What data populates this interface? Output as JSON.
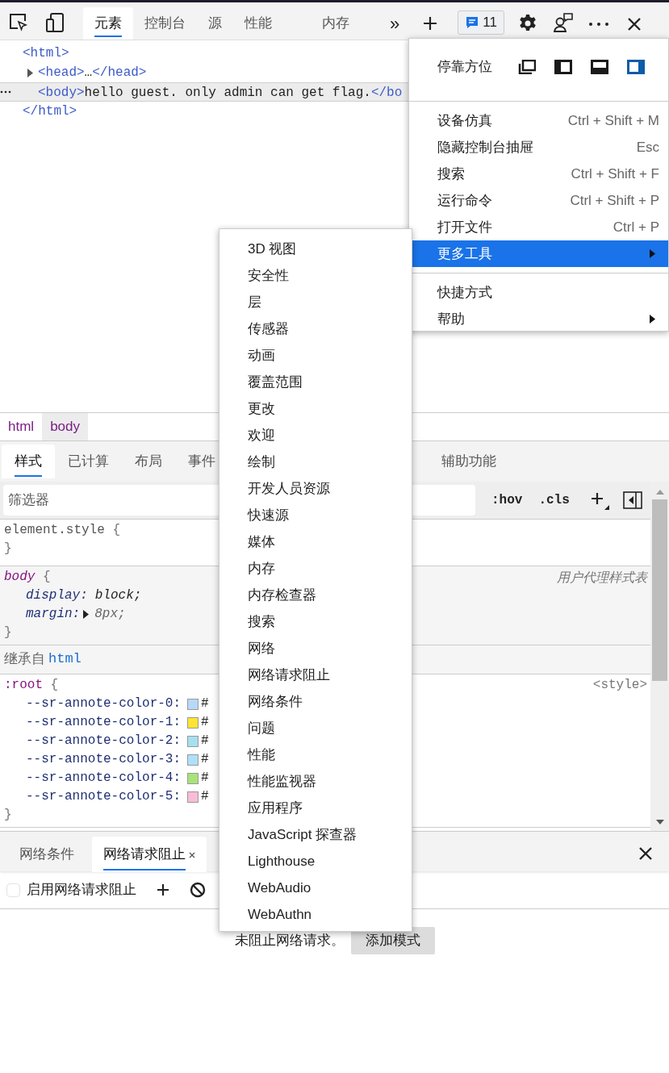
{
  "toolbar": {
    "tabs": [
      {
        "label": "元素",
        "selected": true
      },
      {
        "label": "控制台",
        "selected": false
      },
      {
        "label": "源",
        "selected": false
      },
      {
        "label": "性能",
        "selected": false
      },
      {
        "label": "内存",
        "selected": false
      }
    ],
    "overflow": "»",
    "issues": "11"
  },
  "dom_tree": [
    {
      "parts": [
        {
          "kind": "tag",
          "text": "<html>"
        }
      ],
      "collapsed": false,
      "selected": false,
      "children": [
        {
          "parts": [
            {
              "kind": "tag",
              "text": "<head>"
            },
            {
              "kind": "text",
              "text": "…"
            },
            {
              "kind": "tag",
              "text": "</head>"
            }
          ],
          "collapsed": true,
          "selected": false
        },
        {
          "parts": [
            {
              "kind": "tag",
              "text": "<body>"
            },
            {
              "kind": "text",
              "text": "hello guest. only admin can get flag."
            },
            {
              "kind": "tag",
              "text": "</bo"
            }
          ],
          "collapsed": false,
          "selected": true
        }
      ],
      "closing": [
        {
          "kind": "tag",
          "text": "</html>"
        }
      ]
    }
  ],
  "breadcrumbs": [
    {
      "label": "html",
      "selected": false
    },
    {
      "label": "body",
      "selected": true
    }
  ],
  "styles_tabs": [
    {
      "label": "样式",
      "selected": true
    },
    {
      "label": "已计算",
      "selected": false
    },
    {
      "label": "布局",
      "selected": false
    },
    {
      "label": "事件",
      "selected": false
    },
    {
      "label": "辅助功能",
      "selected": false
    }
  ],
  "filter": {
    "placeholder": "筛选器",
    "toggles": [
      ":hov",
      ".cls"
    ]
  },
  "rules": [
    {
      "kind": "inline",
      "selector": "element.style",
      "open": "{",
      "close": "}"
    },
    {
      "kind": "user-agent",
      "selector": "body",
      "open": "{",
      "close": "}",
      "origin": "用户代理样式表",
      "declarations": [
        {
          "name": "display:",
          "value": "block;",
          "expandable": false
        },
        {
          "name": "margin:",
          "value": "8px;",
          "expandable": true
        }
      ]
    },
    {
      "kind": "inherited",
      "label": "继承自",
      "element": "html"
    },
    {
      "kind": "author",
      "selector": ":root",
      "open": "{",
      "close": "}",
      "origin": "<style>",
      "variables": [
        {
          "name": "--sr-annote-color-0:",
          "color": "#b8d8f8",
          "value": "#"
        },
        {
          "name": "--sr-annote-color-1:",
          "color": "#ffe433",
          "value": "#"
        },
        {
          "name": "--sr-annote-color-2:",
          "color": "#a6e0f0",
          "value": "#"
        },
        {
          "name": "--sr-annote-color-3:",
          "color": "#aee0fa",
          "value": "#"
        },
        {
          "name": "--sr-annote-color-4:",
          "color": "#a8e37a",
          "value": "#"
        },
        {
          "name": "--sr-annote-color-5:",
          "color": "#f8bcd8",
          "value": "#"
        }
      ]
    }
  ],
  "drawer": {
    "tabs": [
      {
        "label": "网络条件",
        "selected": false,
        "closable": false
      },
      {
        "label": "网络请求阻止",
        "selected": true,
        "closable": true
      }
    ],
    "enable": {
      "label": "启用网络请求阻止",
      "checked": false
    },
    "empty_message": "未阻止网络请求。",
    "add_button": "添加模式"
  },
  "main_menu": {
    "dock": {
      "label": "停靠方位",
      "options": [
        {
          "kind": "undock",
          "selected": false
        },
        {
          "kind": "left",
          "selected": false
        },
        {
          "kind": "bottom",
          "selected": false
        },
        {
          "kind": "right",
          "selected": true
        }
      ]
    },
    "groups": [
      [
        {
          "label": "设备仿真",
          "shortcut": "Ctrl + Shift + M",
          "submenu": false,
          "selected": false
        },
        {
          "label": "隐藏控制台抽屉",
          "shortcut": "Esc",
          "submenu": false,
          "selected": false
        },
        {
          "label": "搜索",
          "shortcut": "Ctrl + Shift + F",
          "submenu": false,
          "selected": false
        },
        {
          "label": "运行命令",
          "shortcut": "Ctrl + Shift + P",
          "submenu": false,
          "selected": false
        },
        {
          "label": "打开文件",
          "shortcut": "Ctrl + P",
          "submenu": false,
          "selected": false
        },
        {
          "label": "更多工具",
          "submenu": true,
          "selected": true
        }
      ],
      [
        {
          "label": "快捷方式",
          "submenu": false,
          "selected": false
        },
        {
          "label": "帮助",
          "submenu": true,
          "selected": false
        }
      ]
    ]
  },
  "more_tools_menu": [
    "3D 视图",
    "安全性",
    "层",
    "传感器",
    "动画",
    "覆盖范围",
    "更改",
    "欢迎",
    "绘制",
    "开发人员资源",
    "快速源",
    "媒体",
    "内存",
    "内存检查器",
    "搜索",
    "网络",
    "网络请求阻止",
    "网络条件",
    "问题",
    "性能",
    "性能监视器",
    "应用程序",
    "JavaScript 探查器",
    "Lighthouse",
    "WebAudio",
    "WebAuthn"
  ]
}
